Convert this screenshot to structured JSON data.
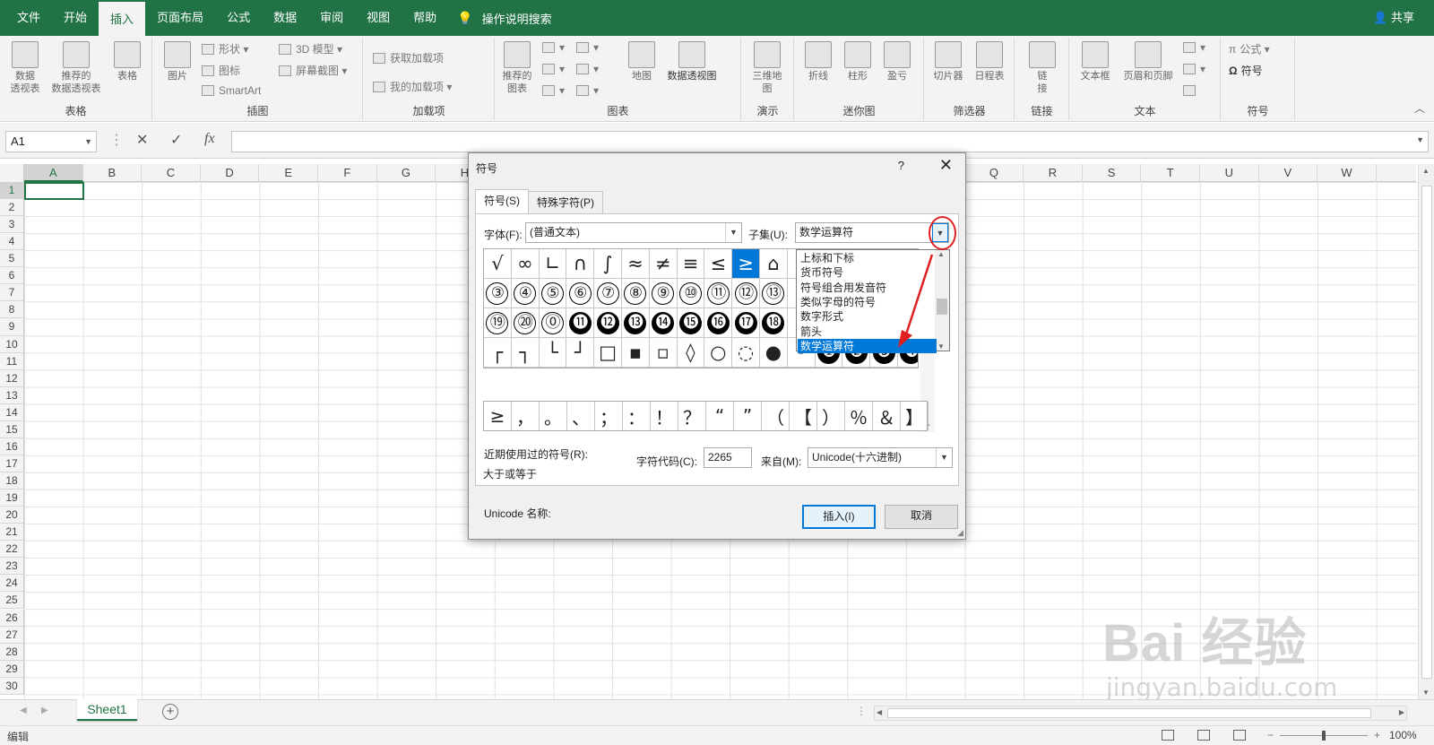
{
  "menubar": {
    "items": [
      "文件",
      "开始",
      "插入",
      "页面布局",
      "公式",
      "数据",
      "审阅",
      "视图",
      "帮助"
    ],
    "active_index": 2,
    "tell_me": "操作说明搜索",
    "share": "共享"
  },
  "ribbon": {
    "groups": [
      {
        "label": "表格",
        "buttons": [
          "数据\n透视表",
          "推荐的\n数据透视表",
          "表格"
        ]
      },
      {
        "label": "插图",
        "buttons": [
          "图片"
        ],
        "small": [
          "形状",
          "图标",
          "SmartArt",
          "3D 模型",
          "屏幕截图"
        ]
      },
      {
        "label": "加载项",
        "small": [
          "获取加载项",
          "我的加载项"
        ]
      },
      {
        "label": "图表",
        "buttons": [
          "推荐的\n图表",
          "地图",
          "数据透视图"
        ]
      },
      {
        "label": "演示",
        "buttons": [
          "三维地\n图"
        ]
      },
      {
        "label": "迷你图",
        "buttons": [
          "折线",
          "柱形",
          "盈亏"
        ]
      },
      {
        "label": "筛选器",
        "buttons": [
          "切片器",
          "日程表"
        ]
      },
      {
        "label": "链接",
        "buttons": [
          "链\n接"
        ]
      },
      {
        "label": "文本",
        "buttons": [
          "文本框",
          "页眉和页脚"
        ]
      },
      {
        "label": "符号",
        "small": [
          "公式",
          "符号"
        ]
      }
    ]
  },
  "formula_bar": {
    "name_box": "A1",
    "cancel_icon": "✕",
    "enter_icon": "✓",
    "fx": "fx",
    "value": ""
  },
  "sheet": {
    "columns": [
      "A",
      "B",
      "C",
      "D",
      "E",
      "F",
      "G",
      "H",
      "I",
      "J",
      "K",
      "L",
      "M",
      "N",
      "O",
      "P",
      "Q",
      "R",
      "S",
      "T",
      "U",
      "V",
      "W"
    ],
    "rows": [
      "1",
      "2",
      "3",
      "4",
      "5",
      "6",
      "7",
      "8",
      "9",
      "10",
      "11",
      "12",
      "13",
      "14",
      "15",
      "16",
      "17",
      "18",
      "19",
      "20",
      "21",
      "22",
      "23",
      "24",
      "25",
      "26",
      "27",
      "28",
      "29",
      "30"
    ],
    "active_cell": "A1",
    "tab": "Sheet1",
    "add_sheet": "+"
  },
  "statusbar": {
    "mode": "编辑",
    "zoom_minus": "−",
    "zoom_plus": "+",
    "zoom": "100%"
  },
  "watermark": {
    "logo": "Bai 经验",
    "url": "jingyan.baidu.com"
  },
  "dialog": {
    "title": "符号",
    "help": "?",
    "close": "✕",
    "tabs": [
      "符号(S)",
      "特殊字符(P)"
    ],
    "font_label": "字体(F):",
    "font_value": "(普通文本)",
    "subset_label": "子集(U):",
    "subset_value": "数学运算符",
    "symbols": [
      [
        "√",
        "∞",
        "∟",
        "∩",
        "∫",
        "≈",
        "≠",
        "≡",
        "≤",
        "≥",
        "⌂",
        "",
        "",
        "",
        "",
        ""
      ],
      [
        "③",
        "④",
        "⑤",
        "⑥",
        "⑦",
        "⑧",
        "⑨",
        "⑩",
        "⑪",
        "⑫",
        "⑬",
        "",
        "",
        "",
        "",
        ""
      ],
      [
        "⑲",
        "⑳",
        "⓪",
        "⓫",
        "⓬",
        "⓭",
        "⓮",
        "⓯",
        "⓰",
        "⓱",
        "⓲",
        "",
        "",
        "",
        "",
        ""
      ],
      [
        "┌",
        "┐",
        "└",
        "┘",
        "□",
        "▪",
        "▫",
        "◊",
        "○",
        "◌",
        "●",
        "◦",
        "❶",
        "❷",
        "❸",
        "❹"
      ]
    ],
    "selected_symbol": "≥",
    "recent_label": "近期使用过的符号(R):",
    "recent": [
      "≥",
      "，",
      "。",
      "、",
      "；",
      "：",
      "！",
      "？",
      "“",
      "”",
      "（",
      "【",
      "）",
      "％",
      "＆",
      "】"
    ],
    "unicode_name_label": "Unicode 名称:",
    "unicode_name": "大于或等于",
    "char_code_label": "字符代码(C):",
    "char_code": "2265",
    "from_label": "来自(M):",
    "from_value": "Unicode(十六进制)",
    "insert_button": "插入(I)",
    "cancel_button": "取消",
    "subset_list": [
      "上标和下标",
      "货币符号",
      "符号组合用发音符",
      "类似字母的符号",
      "数字形式",
      "箭头",
      "数学运算符"
    ],
    "subset_list_selected": 6
  },
  "colors": {
    "excel_green": "#217346",
    "selection_blue": "#0078d7",
    "annotation_red": "#e02020"
  }
}
